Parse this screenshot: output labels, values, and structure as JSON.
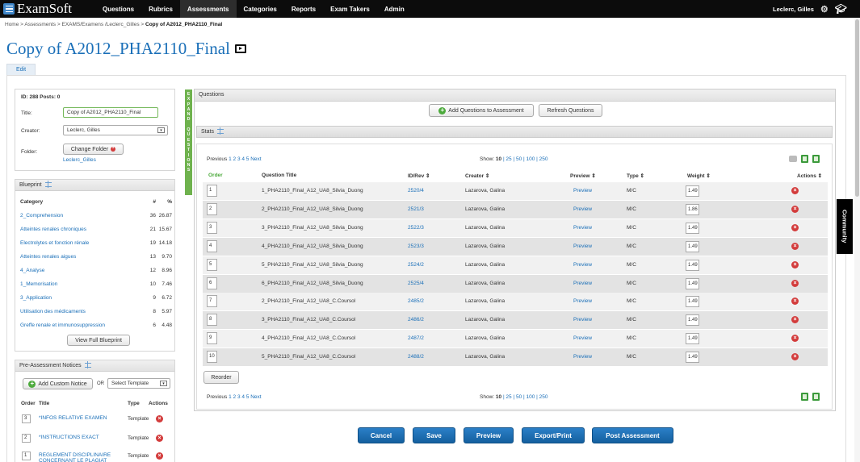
{
  "brand": "ExamSoft",
  "nav": [
    "Questions",
    "Rubrics",
    "Assessments",
    "Categories",
    "Reports",
    "Exam Takers",
    "Admin"
  ],
  "user": "Leclerc, Gilles",
  "breadcrumb": {
    "home": "Home",
    "sep": ">",
    "assessments": "Assessments",
    "folder": "EXAMS/Examens /Leclerc_Gilles",
    "current": "Copy of A2012_PHA2110_Final"
  },
  "title": "Copy of A2012_PHA2110_Final",
  "edit_tab": "Edit",
  "info": {
    "id_posts": "ID: 288 Posts: 0",
    "title_label": "Title:",
    "title_value": "Copy of A2012_PHA2110_Final",
    "creator_label": "Creator:",
    "creator_value": "Leclerc, Gilles",
    "folder_label": "Folder:",
    "change_folder": "Change Folder",
    "folder_value": "Leclerc_Gilles"
  },
  "blueprint": {
    "title": "Blueprint",
    "col_category": "Category",
    "col_count": "#",
    "col_pct": "%",
    "rows": [
      {
        "name": "2_Comprehension",
        "n": "36",
        "p": "26.87"
      },
      {
        "name": "Atteintes renales chroniques",
        "n": "21",
        "p": "15.67"
      },
      {
        "name": "Electrolytes et fonction rénale",
        "n": "19",
        "p": "14.18"
      },
      {
        "name": "Atteintes renales aigues",
        "n": "13",
        "p": "9.70"
      },
      {
        "name": "4_Analyse",
        "n": "12",
        "p": "8.96"
      },
      {
        "name": "1_Memorisation",
        "n": "10",
        "p": "7.46"
      },
      {
        "name": "3_Application",
        "n": "9",
        "p": "6.72"
      },
      {
        "name": "Utilisation des médicaments",
        "n": "8",
        "p": "5.97"
      },
      {
        "name": "Greffe renale et immunosuppression",
        "n": "6",
        "p": "4.48"
      }
    ],
    "view_full": "View Full Blueprint"
  },
  "notices": {
    "title": "Pre-Assessment Notices",
    "add_custom": "Add Custom Notice",
    "or": "OR",
    "select_template": "Select Template",
    "col_order": "Order",
    "col_title": "Title",
    "col_type": "Type",
    "col_actions": "Actions",
    "rows": [
      {
        "order": "3",
        "title": "*INFOS RELATIVE EXAMEN",
        "type": "Template"
      },
      {
        "order": "2",
        "title": "*INSTRUCTIONS EXACT",
        "type": "Template"
      },
      {
        "order": "1",
        "title": "REGLEMENT DISCIPLINAIRE CONCERNANT LE PLAGIAT",
        "type": "Template"
      }
    ]
  },
  "expand_strip": "EXPAND QUESTIONS",
  "questions": {
    "title": "Questions",
    "add_btn": "Add Questions to Assessment",
    "refresh_btn": "Refresh Questions",
    "stats": "Stats",
    "previous": "Previous",
    "pages": "1 2 3 4 5",
    "next": "Next",
    "show_label": "Show:",
    "show_current": "10",
    "show_options": "| 25 | 50 | 100 | 250",
    "headers": [
      "Order",
      "Question Title",
      "ID/Rev ⇕",
      "Creator ⇕",
      "Preview ⇕",
      "Type ⇕",
      "Weight ⇕",
      "Actions ⇕"
    ],
    "rows": [
      {
        "order": "1",
        "title": "1_PHA2110_Final_A12_UA8_Silvia_Duong",
        "idrev": "2520/4",
        "creator": "Lazarova, Galina",
        "preview": "Preview",
        "type": "M/C",
        "weight": "1.49"
      },
      {
        "order": "2",
        "title": "2_PHA2110_Final_A12_UA8_Silvia_Duong",
        "idrev": "2521/3",
        "creator": "Lazarova, Galina",
        "preview": "Preview",
        "type": "M/C",
        "weight": "1.86"
      },
      {
        "order": "3",
        "title": "3_PHA2110_Final_A12_UA8_Silvia_Duong",
        "idrev": "2522/3",
        "creator": "Lazarova, Galina",
        "preview": "Preview",
        "type": "M/C",
        "weight": "1.49"
      },
      {
        "order": "4",
        "title": "4_PHA2110_Final_A12_UA8_Silvia_Duong",
        "idrev": "2523/3",
        "creator": "Lazarova, Galina",
        "preview": "Preview",
        "type": "M/C",
        "weight": "1.49"
      },
      {
        "order": "5",
        "title": "5_PHA2110_Final_A12_UA8_Silvia_Duong",
        "idrev": "2524/2",
        "creator": "Lazarova, Galina",
        "preview": "Preview",
        "type": "M/C",
        "weight": "1.49"
      },
      {
        "order": "6",
        "title": "6_PHA2110_Final_A12_UA8_Silvia_Duong",
        "idrev": "2525/4",
        "creator": "Lazarova, Galina",
        "preview": "Preview",
        "type": "M/C",
        "weight": "1.49"
      },
      {
        "order": "7",
        "title": "2_PHA2110_Final_A12_UA8_C.Coursol",
        "idrev": "2485/2",
        "creator": "Lazarova, Galina",
        "preview": "Preview",
        "type": "M/C",
        "weight": "1.49"
      },
      {
        "order": "8",
        "title": "3_PHA2110_Final_A12_UA8_C.Coursol",
        "idrev": "2486/2",
        "creator": "Lazarova, Galina",
        "preview": "Preview",
        "type": "M/C",
        "weight": "1.49"
      },
      {
        "order": "9",
        "title": "4_PHA2110_Final_A12_UA8_C.Coursol",
        "idrev": "2487/2",
        "creator": "Lazarova, Galina",
        "preview": "Preview",
        "type": "M/C",
        "weight": "1.49"
      },
      {
        "order": "10",
        "title": "5_PHA2110_Final_A12_UA8_C.Coursol",
        "idrev": "2488/2",
        "creator": "Lazarova, Galina",
        "preview": "Preview",
        "type": "M/C",
        "weight": "1.49"
      }
    ],
    "reorder": "Reorder"
  },
  "actions": {
    "cancel": "Cancel",
    "save": "Save",
    "preview": "Preview",
    "export": "Export/Print",
    "post": "Post Assessment"
  },
  "community": "Community",
  "colors": {
    "nav_bg": "#0c0c0c",
    "link": "#1a6fb8",
    "primary_button": "#1b6cb4",
    "green": "#4caa3c",
    "danger": "#d33c3c"
  },
  "icons": [
    "menu-icon",
    "gear-icon",
    "graduation-cap-icon",
    "video-icon",
    "sort-icon",
    "add-icon",
    "remove-icon",
    "printer-icon",
    "excel-icon"
  ]
}
